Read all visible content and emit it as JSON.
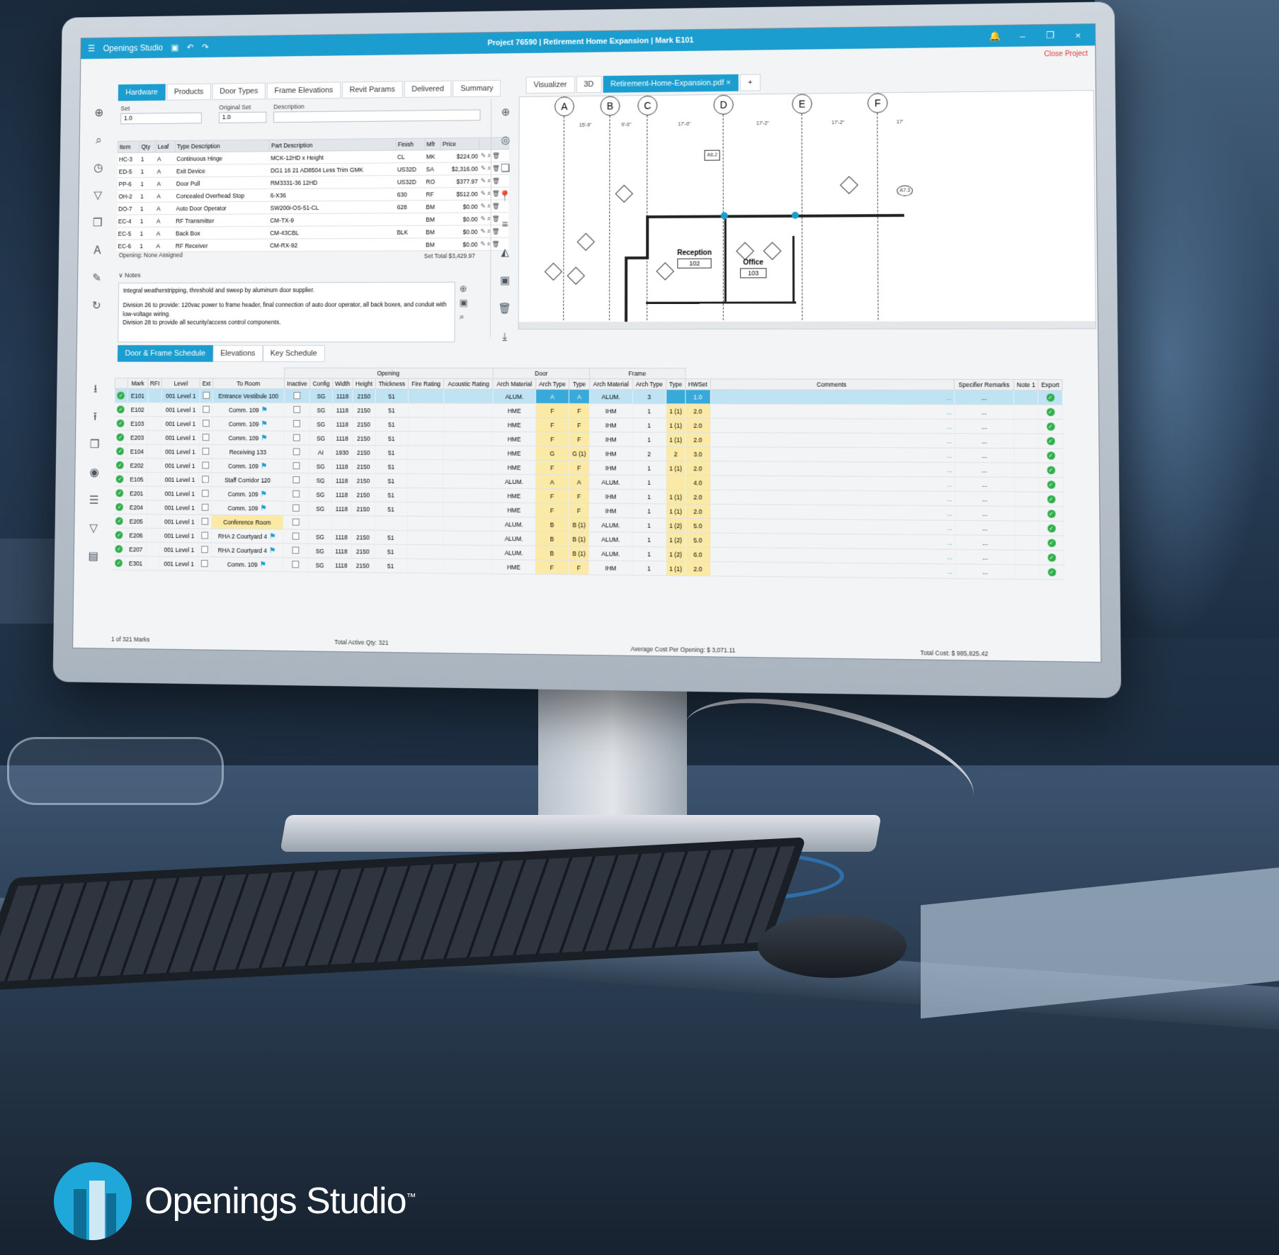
{
  "app": {
    "name": "Openings Studio",
    "window_title": "Project 76590 | Retirement Home Expansion | Mark E101",
    "close_project": "Close Project"
  },
  "hardware_tabs": [
    "Hardware",
    "Products",
    "Door Types",
    "Frame Elevations",
    "Revit Params",
    "Delivered",
    "Summary"
  ],
  "set_fields": {
    "set_label": "Set",
    "set_value": "1.0",
    "original_set_label": "Original Set",
    "original_set_value": "1.0",
    "description_label": "Description"
  },
  "hardware_table": {
    "columns": [
      "Item",
      "Qty",
      "Leaf",
      "Type Description",
      "Part Description",
      "Finish",
      "Mfr",
      "Price"
    ],
    "rows": [
      [
        "HC-3",
        "1",
        "A",
        "Continuous Hinge",
        "MCK-12HD x Height",
        "CL",
        "MK",
        "$224.00"
      ],
      [
        "ED-5",
        "1",
        "A",
        "Exit Device",
        "DG1 16 21 AD8504 Less Trim GMK",
        "US32D",
        "SA",
        "$2,316.00"
      ],
      [
        "PP-6",
        "1",
        "A",
        "Door Pull",
        "RM3331-36 12HD",
        "US32D",
        "RO",
        "$377.97"
      ],
      [
        "OH-2",
        "1",
        "A",
        "Concealed Overhead Stop",
        "6-X36",
        "630",
        "RF",
        "$512.00"
      ],
      [
        "DO-7",
        "1",
        "A",
        "Auto Door Operator",
        "SW200i-OS-51-CL",
        "628",
        "BM",
        "$0.00"
      ],
      [
        "EC-4",
        "1",
        "A",
        "RF Transmitter",
        "CM-TX-9",
        "",
        "BM",
        "$0.00"
      ],
      [
        "EC-5",
        "1",
        "A",
        "Back Box",
        "CM-43CBL",
        "BLK",
        "BM",
        "$0.00"
      ],
      [
        "EC-6",
        "1",
        "A",
        "RF Receiver",
        "CM-RX-92",
        "",
        "BM",
        "$0.00"
      ]
    ],
    "opening_note": "Opening: None Assigned",
    "set_total_label": "Set Total",
    "set_total_value": "$3,429.97"
  },
  "notes": {
    "label": "Notes",
    "line1": "Integral weatherstripping, threshold and sweep by aluminum door supplier.",
    "line2": "Division 26 to provide: 120vac power to frame header, final connection of auto door operator, all back boxes, and conduit with low-voltage wiring.",
    "line3": "Division 28 to provide all security/access control components."
  },
  "viewer_tabs": [
    "Visualizer",
    "3D",
    "Retirement-Home-Expansion.pdf",
    "+"
  ],
  "drawing": {
    "grid_labels": [
      "A",
      "B",
      "C",
      "D",
      "E",
      "F"
    ],
    "dims_top": [
      "15'-9\"",
      "9'-0\"",
      "17'-0\"",
      "17'-2\"",
      "17'-2\"",
      "17'"
    ],
    "rooms": [
      {
        "name": "Reception",
        "num": "102"
      },
      {
        "name": "Office",
        "num": "103"
      }
    ],
    "tag_a62": "A6.2",
    "tag_a73": "A7.3"
  },
  "schedule_tabs": [
    "Door & Frame Schedule",
    "Elevations",
    "Key Schedule"
  ],
  "schedule": {
    "group_headers": {
      "opening": "Opening",
      "door": "Door",
      "frame": "Frame"
    },
    "columns": [
      "",
      "Mark",
      "RFI",
      "Level",
      "Ext",
      "To Room",
      "Inactive",
      "Config",
      "Width",
      "Height",
      "Thickness",
      "Fire Rating",
      "Acoustic Rating",
      "Arch Material",
      "Arch Type",
      "Type",
      "Arch Material",
      "Arch Type",
      "Type",
      "HWSet",
      "Comments",
      "Specifier Remarks",
      "Note 1",
      "Export"
    ],
    "rows": [
      [
        "E101",
        "001 Level 1",
        "Entrance Vestibule 100",
        "SG",
        "1118",
        "2150",
        "51",
        "ALUM.",
        "A",
        "A",
        "ALUM.",
        "3",
        "",
        "1.0",
        false
      ],
      [
        "E102",
        "001 Level 1",
        "Comm. 109",
        "SG",
        "1118",
        "2150",
        "51",
        "HME",
        "F",
        "F",
        "IHM",
        "1",
        "1 (1)",
        "2.0",
        true
      ],
      [
        "E103",
        "001 Level 1",
        "Comm. 109",
        "SG",
        "1118",
        "2150",
        "51",
        "HME",
        "F",
        "F",
        "IHM",
        "1",
        "1 (1)",
        "2.0",
        true
      ],
      [
        "E203",
        "001 Level 1",
        "Comm. 109",
        "SG",
        "1118",
        "2150",
        "51",
        "HME",
        "F",
        "F",
        "IHM",
        "1",
        "1 (1)",
        "2.0",
        true
      ],
      [
        "E104",
        "001 Level 1",
        "Receiving 133",
        "AI",
        "1930",
        "2150",
        "51",
        "HME",
        "G",
        "G (1)",
        "IHM",
        "2",
        "2",
        "3.0",
        false
      ],
      [
        "E202",
        "001 Level 1",
        "Comm. 109",
        "SG",
        "1118",
        "2150",
        "51",
        "HME",
        "F",
        "F",
        "IHM",
        "1",
        "1 (1)",
        "2.0",
        true
      ],
      [
        "E105",
        "001 Level 1",
        "Staff Corridor 120",
        "SG",
        "1118",
        "2150",
        "51",
        "ALUM.",
        "A",
        "A",
        "ALUM.",
        "1",
        "",
        "4.0",
        false
      ],
      [
        "E201",
        "001 Level 1",
        "Comm. 109",
        "SG",
        "1118",
        "2150",
        "51",
        "HME",
        "F",
        "F",
        "IHM",
        "1",
        "1 (1)",
        "2.0",
        true
      ],
      [
        "E204",
        "001 Level 1",
        "Comm. 109",
        "SG",
        "1118",
        "2150",
        "51",
        "HME",
        "F",
        "F",
        "IHM",
        "1",
        "1 (1)",
        "2.0",
        true
      ],
      [
        "E205",
        "001 Level 1",
        "Conference Room",
        "",
        "",
        "",
        "",
        "ALUM.",
        "B",
        "B (1)",
        "ALUM.",
        "1",
        "1 (2)",
        "5.0",
        false
      ],
      [
        "E206",
        "001 Level 1",
        "RHA 2 Courtyard 4",
        "SG",
        "1118",
        "2150",
        "51",
        "ALUM.",
        "B",
        "B (1)",
        "ALUM.",
        "1",
        "1 (2)",
        "5.0",
        true
      ],
      [
        "E207",
        "001 Level 1",
        "RHA 2 Courtyard 4",
        "SG",
        "1118",
        "2150",
        "51",
        "ALUM.",
        "B",
        "B (1)",
        "ALUM.",
        "1",
        "1 (2)",
        "6.0",
        true
      ],
      [
        "E301",
        "001 Level 1",
        "Comm. 109",
        "SG",
        "1118",
        "2150",
        "51",
        "HME",
        "F",
        "F",
        "IHM",
        "1",
        "1 (1)",
        "2.0",
        true
      ]
    ],
    "marks_count": "1 of 321 Marks",
    "total_active": "Total Active Qty: 321",
    "avg_cost": "Average Cost Per Opening: $  3,071.11",
    "total_cost": "Total Cost: $   985,825.42"
  },
  "brand": {
    "text": "Openings Studio",
    "tm": "™"
  },
  "colors": {
    "accent": "#1b9ecf",
    "selected_row": "#bfe3f3",
    "highlight": "#fbe9a6",
    "check": "#2fae4a"
  }
}
